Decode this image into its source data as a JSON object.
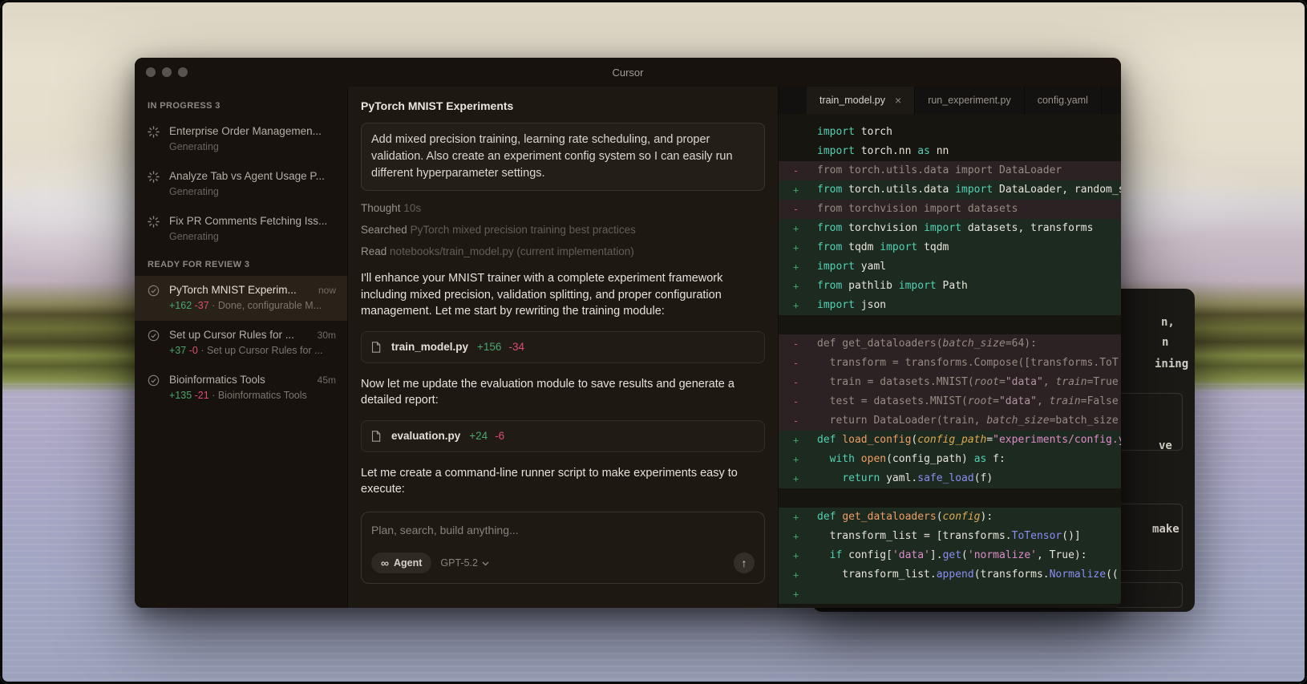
{
  "window": {
    "title": "Cursor"
  },
  "theme": {
    "diff_add": "#3fa368",
    "diff_del": "#d9588b",
    "stat_add": "#4aa571",
    "stat_del": "#d8506e",
    "syntax": {
      "keyword": "#52d1b4",
      "function": "#ef9d66",
      "param": "#e0a952",
      "string": "#de8cc8",
      "method": "#8d8cf3",
      "plain": "#e8e4da",
      "dim": "#958c84"
    }
  },
  "sidebar": {
    "sections": [
      {
        "header": "IN PROGRESS 3",
        "kind": "progress",
        "items": [
          {
            "icon": "spinner-icon",
            "title": "Enterprise Order Managemen...",
            "status": "Generating"
          },
          {
            "icon": "spinner-icon",
            "title": "Analyze Tab vs Agent Usage P...",
            "status": "Generating"
          },
          {
            "icon": "spinner-icon",
            "title": "Fix PR Comments Fetching Iss...",
            "status": "Generating"
          }
        ]
      },
      {
        "header": "READY FOR REVIEW 3",
        "kind": "review",
        "items": [
          {
            "icon": "check-circle-icon",
            "title": "PyTorch MNIST Experim...",
            "time": "now",
            "additions": "+162",
            "deletions": "-37",
            "summary": "· Done, configurable M...",
            "selected": true
          },
          {
            "icon": "check-circle-icon",
            "title": "Set up Cursor Rules for ...",
            "time": "30m",
            "additions": "+37",
            "deletions": "-0",
            "summary": "· Set up Cursor Rules for ..."
          },
          {
            "icon": "check-circle-icon",
            "title": "Bioinformatics Tools",
            "time": "45m",
            "additions": "+135",
            "deletions": "-21",
            "summary": "· Bioinformatics Tools"
          }
        ]
      }
    ]
  },
  "chat": {
    "title": "PyTorch MNIST Experiments",
    "flow": [
      {
        "kind": "user_message",
        "text": "Add mixed precision training, learning rate scheduling, and proper validation. Also create an experiment config system so I can easily run different hyperparameter settings."
      },
      {
        "kind": "meta",
        "label": "Thought",
        "value": "10s"
      },
      {
        "kind": "meta",
        "label": "Searched",
        "value": "PyTorch mixed precision training best practices"
      },
      {
        "kind": "meta",
        "label": "Read",
        "value": "notebooks/train_model.py (current implementation)"
      },
      {
        "kind": "text",
        "text": "I'll enhance your MNIST trainer with a complete experiment framework including mixed precision, validation splitting, and proper configuration management. Let me start by rewriting the training module:"
      },
      {
        "kind": "file_chip",
        "icon": "file-icon",
        "name": "train_model.py",
        "additions": "+156",
        "deletions": "-34"
      },
      {
        "kind": "text",
        "text": "Now let me update the evaluation module to save results and generate a detailed report:"
      },
      {
        "kind": "file_chip",
        "icon": "file-icon",
        "name": "evaluation.py",
        "additions": "+24",
        "deletions": "-6"
      },
      {
        "kind": "text",
        "text": "Let me create a command-line runner script to make experiments easy to execute:"
      }
    ],
    "composer": {
      "placeholder": "Plan, search, build anything...",
      "mode_icon": "infinity-icon",
      "mode": "Agent",
      "model": "GPT-5.2",
      "model_chevron": "chevron-down-icon",
      "send_icon": "arrow-up-icon",
      "send_glyph": "↑",
      "infinity_glyph": "∞"
    }
  },
  "editor": {
    "tabs": [
      {
        "label": "train_model.py",
        "active": true,
        "close_glyph": "×"
      },
      {
        "label": "run_experiment.py"
      },
      {
        "label": "config.yaml"
      }
    ],
    "code_lines": [
      {
        "kind": "ctx",
        "tokens": [
          [
            "k",
            "import"
          ],
          [
            "t",
            " torch"
          ]
        ]
      },
      {
        "kind": "ctx",
        "tokens": [
          [
            "k",
            "import"
          ],
          [
            "t",
            " torch.nn "
          ],
          [
            "k",
            "as"
          ],
          [
            "t",
            " nn"
          ]
        ]
      },
      {
        "kind": "del",
        "tokens": [
          [
            "d",
            "from torch.utils.data import DataLoader"
          ]
        ]
      },
      {
        "kind": "add",
        "tokens": [
          [
            "k",
            "from"
          ],
          [
            "t",
            " torch.utils.data "
          ],
          [
            "k",
            "import"
          ],
          [
            "t",
            " DataLoader, random_s"
          ]
        ]
      },
      {
        "kind": "del",
        "tokens": [
          [
            "d",
            "from torchvision import datasets"
          ]
        ]
      },
      {
        "kind": "add",
        "tokens": [
          [
            "k",
            "from"
          ],
          [
            "t",
            " torchvision "
          ],
          [
            "k",
            "import"
          ],
          [
            "t",
            " datasets, transforms"
          ]
        ]
      },
      {
        "kind": "add",
        "tokens": [
          [
            "k",
            "from"
          ],
          [
            "t",
            " tqdm "
          ],
          [
            "k",
            "import"
          ],
          [
            "t",
            " tqdm"
          ]
        ]
      },
      {
        "kind": "add",
        "tokens": [
          [
            "k",
            "import"
          ],
          [
            "t",
            " yaml"
          ]
        ]
      },
      {
        "kind": "add",
        "tokens": [
          [
            "k",
            "from"
          ],
          [
            "t",
            " pathlib "
          ],
          [
            "k",
            "import"
          ],
          [
            "t",
            " Path"
          ]
        ]
      },
      {
        "kind": "add",
        "tokens": [
          [
            "k",
            "import"
          ],
          [
            "t",
            " json"
          ]
        ]
      },
      {
        "kind": "blank",
        "tokens": []
      },
      {
        "kind": "del",
        "tokens": [
          [
            "d",
            "def get_dataloaders("
          ],
          [
            "di",
            "batch_size"
          ],
          [
            "d",
            "=64):"
          ]
        ]
      },
      {
        "kind": "del",
        "tokens": [
          [
            "d",
            "  transform = transforms.Compose([transforms.ToT"
          ]
        ]
      },
      {
        "kind": "del",
        "tokens": [
          [
            "d",
            "  train = datasets.MNIST("
          ],
          [
            "di",
            "root"
          ],
          [
            "d",
            "="
          ],
          [
            "ds",
            "\"data\""
          ],
          [
            "d",
            ", "
          ],
          [
            "di",
            "train"
          ],
          [
            "d",
            "=True"
          ]
        ]
      },
      {
        "kind": "del",
        "tokens": [
          [
            "d",
            "  test = datasets.MNIST("
          ],
          [
            "di",
            "root"
          ],
          [
            "d",
            "="
          ],
          [
            "ds",
            "\"data\""
          ],
          [
            "d",
            ", "
          ],
          [
            "di",
            "train"
          ],
          [
            "d",
            "=False"
          ]
        ]
      },
      {
        "kind": "del",
        "tokens": [
          [
            "d",
            "  return DataLoader(train, "
          ],
          [
            "di",
            "batch_size"
          ],
          [
            "d",
            "=batch_size"
          ]
        ]
      },
      {
        "kind": "add",
        "tokens": [
          [
            "k",
            "def"
          ],
          [
            "t",
            " "
          ],
          [
            "f",
            "load_config"
          ],
          [
            "t",
            "("
          ],
          [
            "p",
            "config_path"
          ],
          [
            "t",
            "="
          ],
          [
            "s",
            "\"experiments/config.y"
          ]
        ]
      },
      {
        "kind": "add",
        "tokens": [
          [
            "t",
            "  "
          ],
          [
            "k",
            "with"
          ],
          [
            "t",
            " "
          ],
          [
            "f",
            "open"
          ],
          [
            "t",
            "(config_path) "
          ],
          [
            "k",
            "as"
          ],
          [
            "t",
            " f:"
          ]
        ]
      },
      {
        "kind": "add",
        "tokens": [
          [
            "t",
            "    "
          ],
          [
            "k",
            "return"
          ],
          [
            "t",
            " yaml."
          ],
          [
            "m",
            "safe_load"
          ],
          [
            "t",
            "(f)"
          ]
        ]
      },
      {
        "kind": "blank",
        "tokens": []
      },
      {
        "kind": "add",
        "tokens": [
          [
            "k",
            "def"
          ],
          [
            "t",
            " "
          ],
          [
            "f",
            "get_dataloaders"
          ],
          [
            "t",
            "("
          ],
          [
            "p",
            "config"
          ],
          [
            "t",
            "):"
          ]
        ]
      },
      {
        "kind": "add",
        "tokens": [
          [
            "t",
            "  transform_list = [transforms."
          ],
          [
            "m",
            "ToTensor"
          ],
          [
            "t",
            "()]"
          ]
        ]
      },
      {
        "kind": "add",
        "tokens": [
          [
            "t",
            "  "
          ],
          [
            "k",
            "if"
          ],
          [
            "t",
            " config["
          ],
          [
            "s",
            "'data'"
          ],
          [
            "t",
            "]."
          ],
          [
            "m",
            "get"
          ],
          [
            "t",
            "("
          ],
          [
            "s",
            "'normalize'"
          ],
          [
            "t",
            ", True):"
          ]
        ]
      },
      {
        "kind": "add",
        "tokens": [
          [
            "t",
            "    transform_list."
          ],
          [
            "m",
            "append"
          ],
          [
            "t",
            "(transforms."
          ],
          [
            "m",
            "Normalize"
          ],
          [
            "t",
            "(("
          ]
        ]
      },
      {
        "kind": "add",
        "tokens": [
          [
            "t",
            ""
          ]
        ]
      }
    ]
  },
  "background_window": {
    "fragments": [
      "n,",
      "n",
      "ining",
      "ve",
      "make"
    ]
  }
}
